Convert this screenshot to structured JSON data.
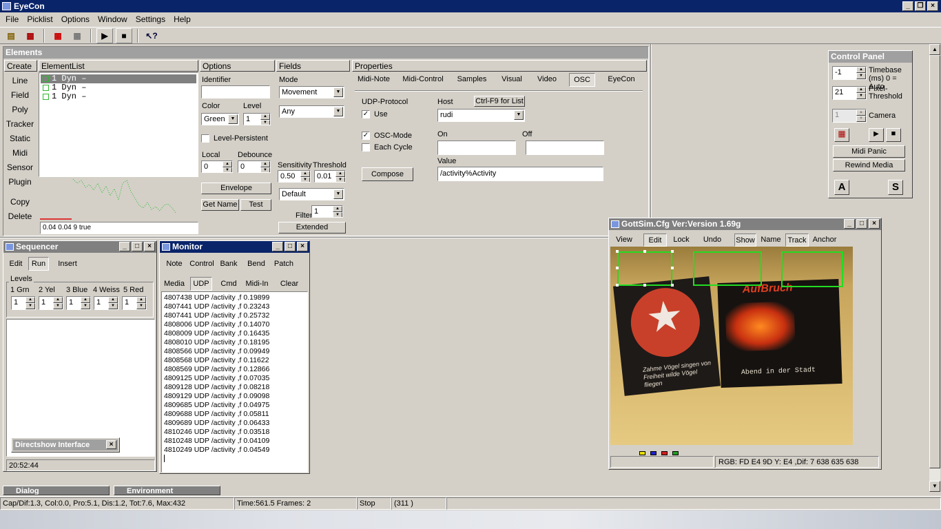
{
  "app": {
    "title": "EyeCon"
  },
  "menu": [
    "File",
    "Picklist",
    "Options",
    "Window",
    "Settings",
    "Help"
  ],
  "elements": {
    "title": "Elements",
    "headers": {
      "create": "Create",
      "elementlist": "ElementList",
      "options": "Options",
      "fields": "Fields",
      "properties": "Properties"
    },
    "create_buttons": [
      "Line",
      "Field",
      "Poly",
      "Tracker",
      "Static",
      "Midi",
      "Sensor",
      "Plugin",
      "Copy",
      "Delete"
    ],
    "list_items": [
      "1 Dyn  –",
      "1 Dyn  –",
      "1 Dyn  –"
    ],
    "graph_status": "0.04  0.04  9  true",
    "options": {
      "identifier_label": "Identifier",
      "identifier_value": "",
      "color_label": "Color",
      "color_value": "Green",
      "level_label": "Level",
      "level_value": "1",
      "level_persistent_label": "Level-Persistent",
      "local_label": "Local",
      "local_value": "0",
      "debounce_label": "Debounce",
      "debounce_value": "0",
      "envelope_btn": "Envelope",
      "getname_btn": "Get Name",
      "test_btn": "Test"
    },
    "fields": {
      "mode_label": "Mode",
      "mode_value": "Movement",
      "any_value": "Any",
      "sensitivity_label": "Sensitivity",
      "sensitivity_value": "0.50",
      "threshold_label": "Threshold",
      "threshold_value": "0.01",
      "default_value": "Default",
      "filter_label": "Filter",
      "filter_value": "1",
      "extended_btn": "Extended"
    },
    "properties": {
      "tabs": [
        "Midi-Note",
        "Midi-Control",
        "Samples",
        "Visual",
        "Video",
        "OSC",
        "EyeCon"
      ],
      "selected_tab": "OSC",
      "udp_label": "UDP-Protocol",
      "use_label": "Use",
      "host_label": "Host",
      "ctrl_btn": "Ctrl-F9 for List",
      "host_value": "rudi",
      "oscmode_label": "OSC-Mode",
      "eachcycle_label": "Each Cycle",
      "on_label": "On",
      "off_label": "Off",
      "on_value": "",
      "off_value": "",
      "compose_btn": "Compose",
      "value_label": "Value",
      "value_value": "/activity%Activity"
    }
  },
  "control_panel": {
    "title": "Control Panel",
    "timebase_value": "-1",
    "timebase_label": "Timebase (ms) 0 = Auto",
    "pixel_value": "21",
    "pixel_label": "Pixel-Threshold",
    "camera_value": "1",
    "camera_label": "Camera",
    "midi_panic": "Midi Panic",
    "rewind_media": "Rewind Media",
    "a_btn": "A",
    "s_btn": "S"
  },
  "sequencer": {
    "title": "Sequencer",
    "tabs": [
      "Edit",
      "Run",
      "Insert"
    ],
    "selected_tab": "Run",
    "levels_label": "Levels",
    "levels": [
      {
        "name": "1 Grn",
        "value": "1"
      },
      {
        "name": "2 Yel",
        "value": "1"
      },
      {
        "name": "3 Blue",
        "value": "1"
      },
      {
        "name": "4 Weiss",
        "value": "1"
      },
      {
        "name": "5 Red",
        "value": "1"
      }
    ],
    "directshow": "Directshow Interface",
    "time": "20:52:44"
  },
  "monitor": {
    "title": "Monitor",
    "row1": [
      "Note",
      "Control",
      "Bank",
      "Bend",
      "Patch"
    ],
    "row2": [
      "Media",
      "UDP",
      "Cmd",
      "Midi-In",
      "Clear"
    ],
    "selected": "UDP",
    "lines": [
      "4807438 UDP /activity ,f 0.19899",
      "4807441 UDP /activity ,f 0.23243",
      "4807441 UDP /activity ,f 0.25732",
      "4808006 UDP /activity ,f 0.14070",
      "4808009 UDP /activity ,f 0.16435",
      "4808010 UDP /activity ,f 0.18195",
      "4808566 UDP /activity ,f 0.09949",
      "4808568 UDP /activity ,f 0.11622",
      "4808569 UDP /activity ,f 0.12866",
      "4809125 UDP /activity ,f 0.07035",
      "4809128 UDP /activity ,f 0.08218",
      "4809129 UDP /activity ,f 0.09098",
      "4809685 UDP /activity ,f 0.04975",
      "4809688 UDP /activity ,f 0.05811",
      "4809689 UDP /activity ,f 0.06433",
      "4810246 UDP /activity ,f 0.03518",
      "4810248 UDP /activity ,f 0.04109",
      "4810249 UDP /activity ,f 0.04549"
    ]
  },
  "video": {
    "title": "GottSim.Cfg Ver:Version 1.69g",
    "toolbar": [
      "View",
      "Edit",
      "Lock",
      "Undo",
      "Show",
      "Name",
      "Track",
      "Anchor"
    ],
    "poster_left_text": "Zahme Vögel singen von Freiheit wilde Vögel fliegen",
    "poster_right_title": "AufBruch",
    "poster_right_text": "Abend in der Stadt",
    "status": "RGB: FD E4 9D  Y: E4 ,Dif: 7 638 635 638"
  },
  "bottom_tabs": [
    "Dialog",
    "Environment"
  ],
  "status": {
    "cap": "Cap/Dif:1.3, Col:0.0, Pro:5.1, Dis:1.2, Tot:7.6, Max:432",
    "time": "Time:561.5 Frames: 2",
    "stop": "Stop",
    "count": "(311 )"
  },
  "colors": {
    "title_active": "#0a246a",
    "title_inactive": "#808080",
    "face": "#d4d0c8",
    "graph_green": "#2db82d",
    "region_green": "#22dd22"
  }
}
